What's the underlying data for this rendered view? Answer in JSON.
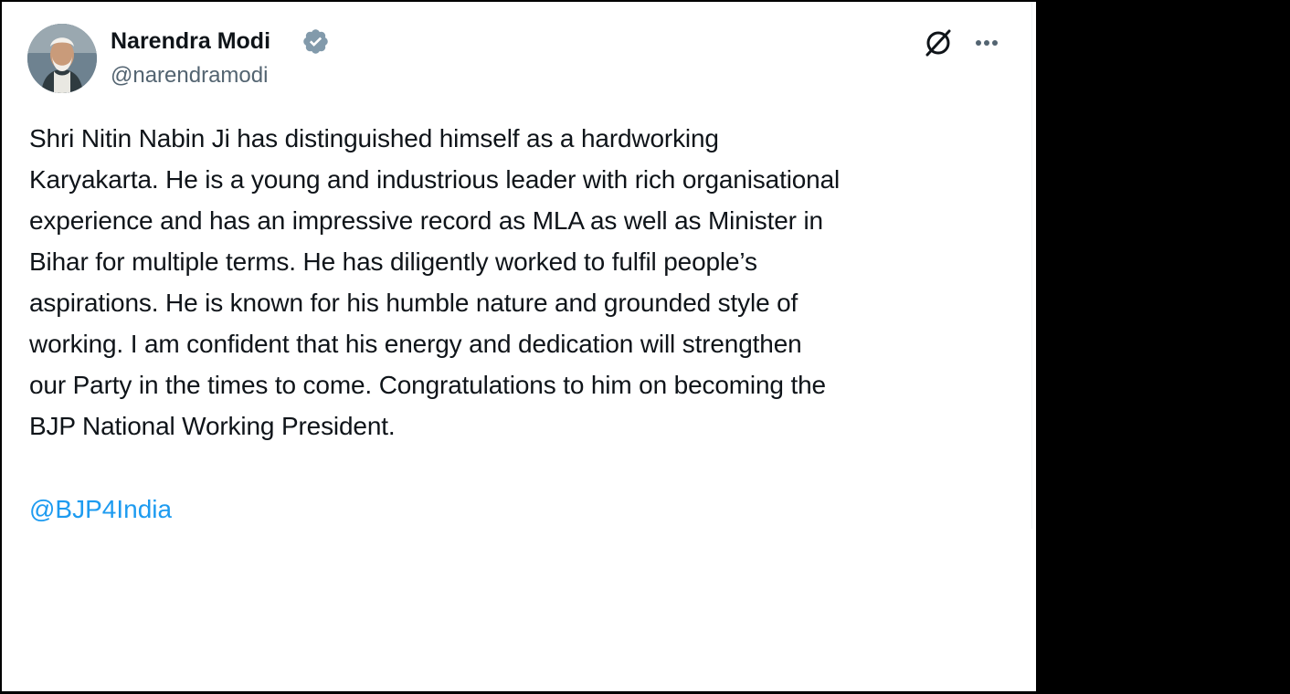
{
  "post": {
    "author": {
      "name": "Narendra Modi",
      "handle": "@narendramodi",
      "verified": true
    },
    "text": "Shri Nitin Nabin Ji has distinguished himself as a hardworking\nKaryakarta. He is a young and industrious leader with rich organisational\nexperience and has an impressive record as MLA as well as Minister in\nBihar for multiple terms. He has diligently worked to fulfil people’s\naspirations. He is known for his humble nature and grounded style of\nworking. I am confident that his energy and dedication will strengthen\nour Party in the times to come. Congratulations to him on becoming the\nBJP National Working President.",
    "mention": "@BJP4India"
  },
  "icons": {
    "verified": "verified-badge-icon",
    "grok": "grok-icon",
    "more": "more-options-icon"
  },
  "colors": {
    "text_primary": "#0f1419",
    "text_secondary": "#536471",
    "link": "#1d9bf0",
    "verified_badge": "#829aab",
    "background": "#ffffff",
    "frame": "#000000"
  }
}
